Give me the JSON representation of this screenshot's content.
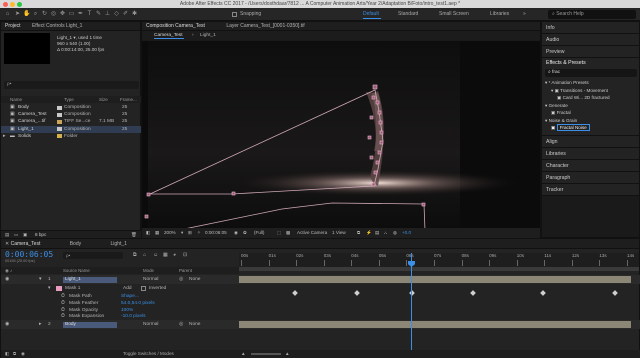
{
  "window": {
    "title": "Adobe After Effects CC 2017 - /Users/dosthdaar/7812 ... A Computer Animation Arts/Year 2/Adaptation B/Foto/intro_test1.aep *"
  },
  "toolbar": {
    "snapping_label": "Snapping",
    "workspaces": [
      "Default",
      "Standard",
      "Small Screen",
      "Libraries"
    ],
    "active_workspace": "Default",
    "search_placeholder": "Search Help"
  },
  "project_panel": {
    "tabs": [
      "Project",
      "Effect Controls Light_1"
    ],
    "selected_item": {
      "name": "Light_1 ▾, used 1 time",
      "size": "960 x 540 (1.00)",
      "duration": "Δ 0:00:14:00, 25.00 fps"
    },
    "search_placeholder": "ρ•",
    "columns": [
      "Name",
      "Type",
      "Size",
      "Frame..."
    ],
    "items": [
      {
        "name": "Body",
        "type": "Composition",
        "size": "",
        "frame": "25",
        "color": "#c9c9c9"
      },
      {
        "name": "Camera_Test",
        "type": "Composition",
        "size": "",
        "frame": "25",
        "color": "#c9c9c9"
      },
      {
        "name": "Camera_...tif",
        "type": "TIFF Se...ce",
        "size": "7.1 MB",
        "frame": "25",
        "color": "#c9a45a"
      },
      {
        "name": "Light_1",
        "type": "Composition",
        "size": "",
        "frame": "25",
        "color": "#c9c9c9"
      },
      {
        "name": "Solids",
        "type": "Folder",
        "size": "",
        "frame": "",
        "color": "#d4b04a"
      }
    ],
    "footer_bpc": "8 bpc"
  },
  "comp_panel": {
    "tab_title": "Composition Camera_Test",
    "layer_tab": "Layer Camera_Test_[0001-0350].tif",
    "breadcrumbs": [
      "Camera_Test",
      "Light_1"
    ],
    "zoom": "200%",
    "timecode": "0:00:06:05",
    "resolution": "(Full)",
    "camera": "Active Camera",
    "views": "1 View",
    "exposure": "+0.0"
  },
  "right_panels": {
    "top": [
      "Info",
      "Audio",
      "Preview"
    ],
    "effects_title": "Effects & Presets",
    "effects_search": "frac",
    "effects_tree": [
      {
        "label": "* Animation Presets",
        "indent": 0
      },
      {
        "label": "Transitions - Movement",
        "indent": 1
      },
      {
        "label": "Card Wi... 2D fractured",
        "indent": 2
      },
      {
        "label": "Generate",
        "indent": 0
      },
      {
        "label": "Fractal",
        "indent": 1
      },
      {
        "label": "Noise & Grain",
        "indent": 0
      },
      {
        "label": "Fractal Noise",
        "indent": 1
      }
    ],
    "bottom": [
      "Align",
      "Libraries",
      "Character",
      "Paragraph",
      "Tracker"
    ]
  },
  "timeline": {
    "tabs": [
      "Camera_Test",
      "Body",
      "Light_1"
    ],
    "timecode": "0:00:06:05",
    "timecode_sub": "00155 (25.00 fps)",
    "search_placeholder": "ρ•",
    "columns": {
      "source": "Source Name",
      "mode": "Mode",
      "parent": "Parent"
    },
    "ruler": [
      "00s",
      "01s",
      "02s",
      "03s",
      "04s",
      "05s",
      "06s",
      "07s",
      "08s",
      "09s",
      "10s",
      "11s",
      "12s",
      "13s",
      "14s"
    ],
    "layers": [
      {
        "index": "1",
        "name": "Light_1",
        "mode": "Normal",
        "parent": "None"
      },
      {
        "index": "2",
        "name": "Body",
        "mode": "Normal",
        "parent": "None"
      }
    ],
    "mask": {
      "name": "Mask 1",
      "mode": "Add",
      "inverted_label": "Inverted"
    },
    "mask_props": [
      {
        "name": "Mask Path",
        "value": "Shape..."
      },
      {
        "name": "Mask Feather",
        "value": "54.0,54.0 pixels"
      },
      {
        "name": "Mask Opacity",
        "value": "100%"
      },
      {
        "name": "Mask Expansion",
        "value": "-10.0 pixels"
      }
    ],
    "footer": "Toggle Switches / Modes"
  },
  "colors": {
    "accent": "#3b8fe6",
    "mask_path": "#e79bbf",
    "playhead": "#3b8fe6",
    "layer_bar": "#8c8676"
  }
}
